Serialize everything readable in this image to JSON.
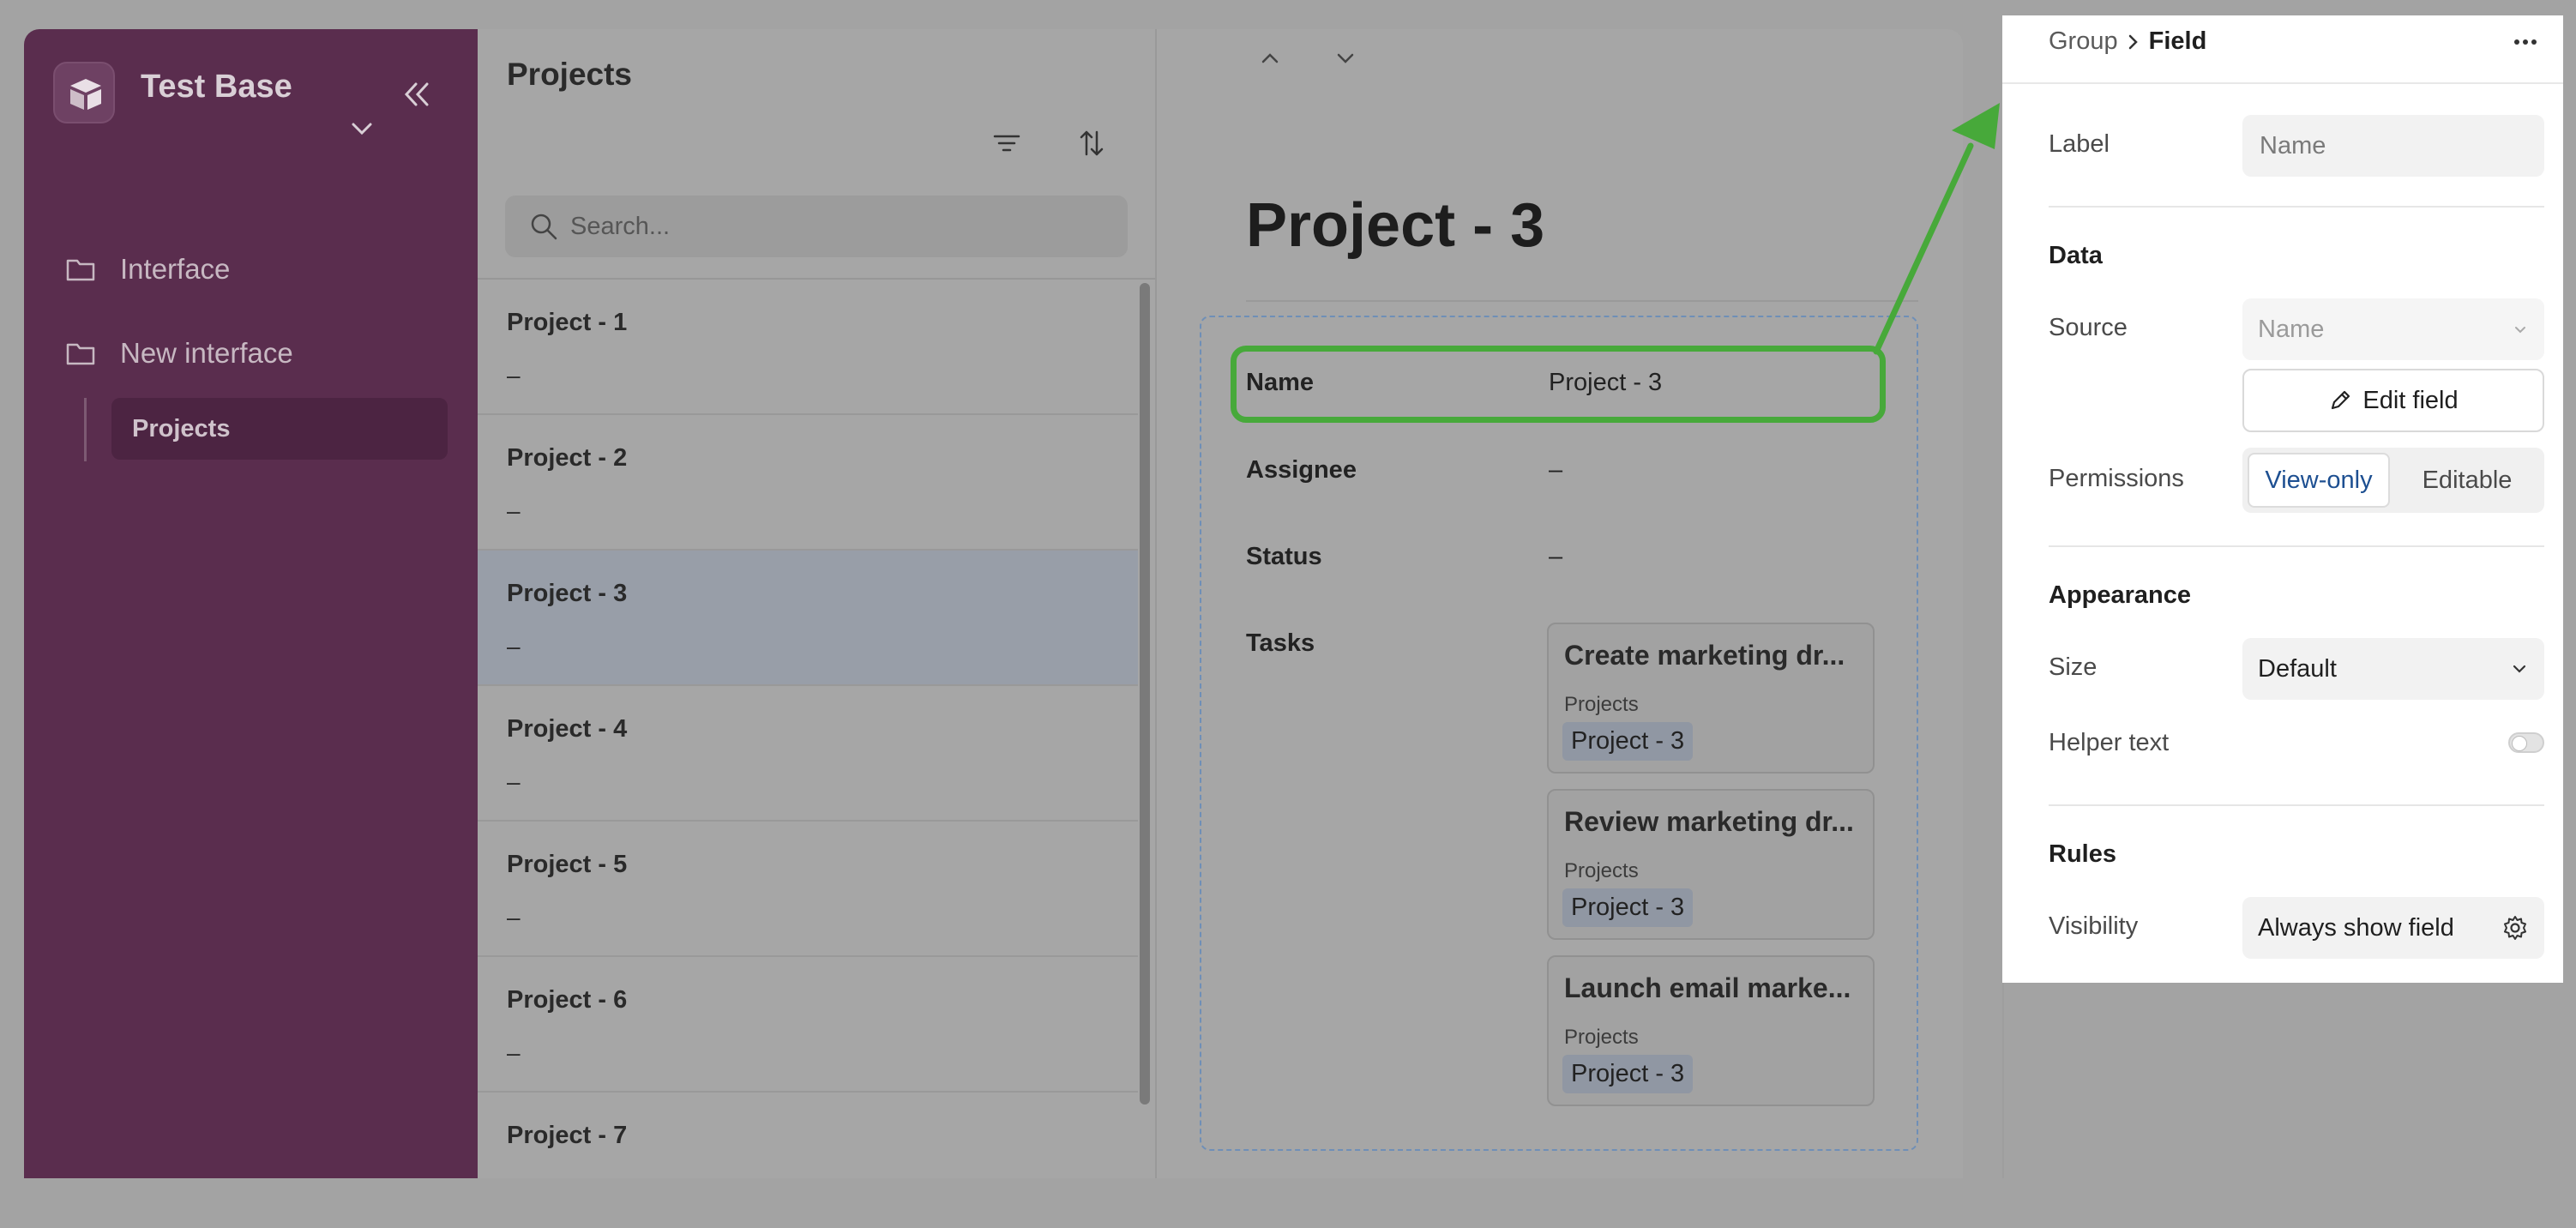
{
  "sidebar": {
    "base_name": "Test Base",
    "nav": [
      {
        "label": "Interface",
        "icon": "folder-icon"
      },
      {
        "label": "New interface",
        "icon": "folder-icon"
      },
      {
        "label": "Projects"
      }
    ]
  },
  "list": {
    "title": "Projects",
    "search_placeholder": "Search...",
    "rows": [
      {
        "name": "Project - 1",
        "sub": "–"
      },
      {
        "name": "Project - 2",
        "sub": "–"
      },
      {
        "name": "Project - 3",
        "sub": "–",
        "selected": true
      },
      {
        "name": "Project - 4",
        "sub": "–"
      },
      {
        "name": "Project - 5",
        "sub": "–"
      },
      {
        "name": "Project - 6",
        "sub": "–"
      },
      {
        "name": "Project - 7",
        "sub": ""
      }
    ]
  },
  "detail": {
    "title": "Project - 3",
    "fields": [
      {
        "label": "Name",
        "value": "Project - 3"
      },
      {
        "label": "Assignee",
        "value": "–"
      },
      {
        "label": "Status",
        "value": "–"
      },
      {
        "label": "Tasks"
      }
    ],
    "tasks": [
      {
        "name": "Create marketing dr...",
        "table": "Projects",
        "chip": "Project - 3"
      },
      {
        "name": "Review marketing dr...",
        "table": "Projects",
        "chip": "Project - 3"
      },
      {
        "name": "Launch email marke...",
        "table": "Projects",
        "chip": "Project - 3"
      }
    ]
  },
  "props": {
    "breadcrumb_group": "Group",
    "breadcrumb_field": "Field",
    "label_label": "Label",
    "label_placeholder": "Name",
    "section_data": "Data",
    "source_label": "Source",
    "source_value": "Name",
    "edit_field": "Edit field",
    "permissions_label": "Permissions",
    "perm_view_only": "View-only",
    "perm_editable": "Editable",
    "section_appearance": "Appearance",
    "size_label": "Size",
    "size_value": "Default",
    "helper_text_label": "Helper text",
    "section_rules": "Rules",
    "visibility_label": "Visibility",
    "visibility_value": "Always show field"
  },
  "colors": {
    "sidebar": "#5a2d4e",
    "highlight": "#47a93a",
    "link_blue": "#1d4f91"
  }
}
